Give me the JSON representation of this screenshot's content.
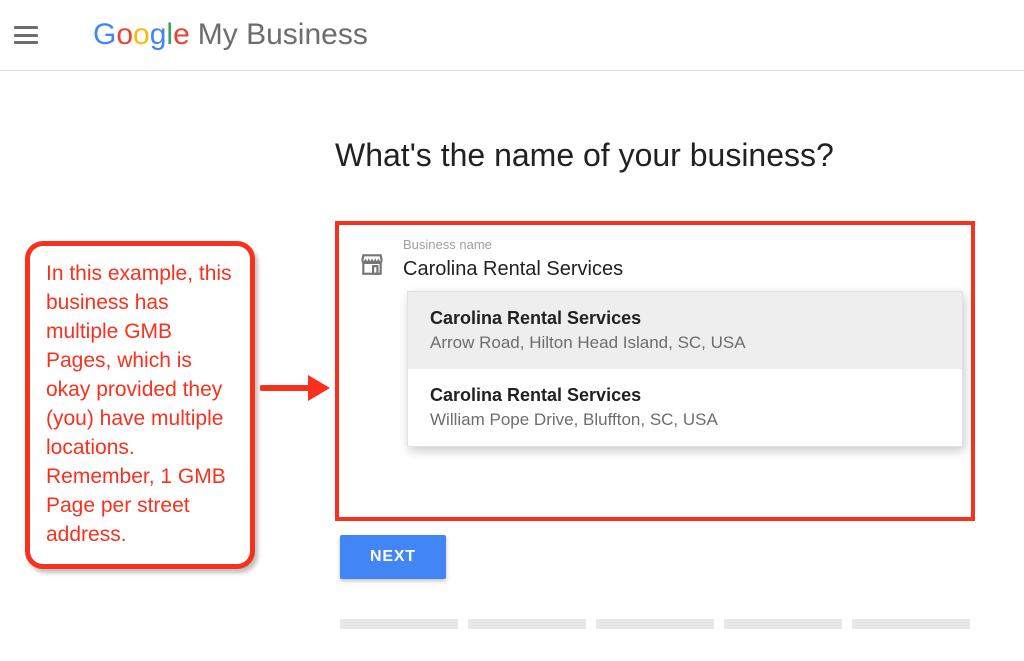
{
  "header": {
    "google_letters": [
      "G",
      "o",
      "o",
      "g",
      "l",
      "e"
    ],
    "product_name": "My Business"
  },
  "page_title": "What's the name of your business?",
  "annotation": {
    "text": "In this example, this business has multiple GMB Pages, which is okay provided they (you) have multiple locations. Remember, 1 GMB Page per street address."
  },
  "form": {
    "field_label": "Business name",
    "input_value": "Carolina Rental Services",
    "suggestions": [
      {
        "name": "Carolina Rental Services",
        "address": "Arrow Road, Hilton Head Island, SC, USA",
        "highlight": true
      },
      {
        "name": "Carolina Rental Services",
        "address": "William Pope Drive, Bluffton, SC, USA",
        "highlight": false
      }
    ],
    "next_label": "NEXT"
  },
  "icons": {
    "store": "store-icon",
    "menu": "menu-icon",
    "arrow": "arrow-icon"
  }
}
